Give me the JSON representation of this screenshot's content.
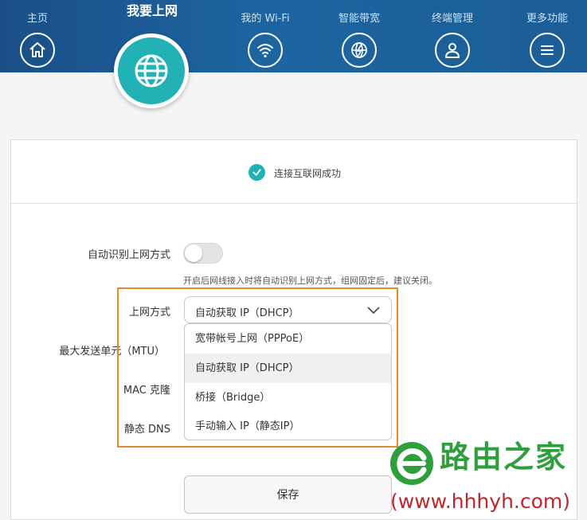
{
  "nav": {
    "home": "主页",
    "internet": "我要上网",
    "wifi": "我的 Wi-Fi",
    "bandwidth": "智能带宽",
    "devices": "终端管理",
    "more": "更多功能"
  },
  "status": {
    "text": "连接互联网成功"
  },
  "form": {
    "auto_detect_label": "自动识别上网方式",
    "auto_detect_on": false,
    "auto_detect_hint": "开启后网线接入时将自动识别上网方式，组网固定后，建议关闭。",
    "mode_label": "上网方式",
    "mode_value": "自动获取 IP（DHCP）",
    "mode_options": [
      "宽带帐号上网（PPPoE）",
      "自动获取 IP（DHCP）",
      "桥接（Bridge）",
      "手动输入 IP（静态IP）"
    ],
    "mtu_label": "最大发送单元（MTU）",
    "mac_label": "MAC 克隆",
    "dns_label": "静态 DNS",
    "save_label": "保存"
  },
  "colors": {
    "accent": "#22b1b5",
    "header": "#1d65a1",
    "highlight": "#e58a2c"
  },
  "watermark": {
    "title": "路由之家",
    "url": "(www.hhhyh.com)"
  }
}
